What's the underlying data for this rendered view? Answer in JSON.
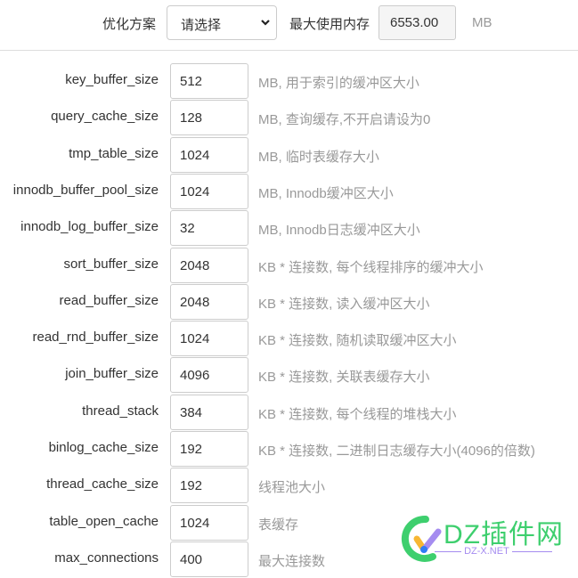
{
  "toolbar": {
    "scheme_label": "优化方案",
    "scheme_select_value": "请选择",
    "max_memory_label": "最大使用内存",
    "max_memory_value": "6553.00",
    "max_memory_unit": "MB"
  },
  "params": [
    {
      "name": "key_buffer_size",
      "value": "512",
      "desc": "MB, 用于索引的缓冲区大小"
    },
    {
      "name": "query_cache_size",
      "value": "128",
      "desc": "MB, 查询缓存,不开启请设为0"
    },
    {
      "name": "tmp_table_size",
      "value": "1024",
      "desc": "MB, 临时表缓存大小"
    },
    {
      "name": "innodb_buffer_pool_size",
      "value": "1024",
      "desc": "MB, Innodb缓冲区大小"
    },
    {
      "name": "innodb_log_buffer_size",
      "value": "32",
      "desc": "MB, Innodb日志缓冲区大小"
    },
    {
      "name": "sort_buffer_size",
      "value": "2048",
      "desc": "KB * 连接数, 每个线程排序的缓冲大小"
    },
    {
      "name": "read_buffer_size",
      "value": "2048",
      "desc": "KB * 连接数, 读入缓冲区大小"
    },
    {
      "name": "read_rnd_buffer_size",
      "value": "1024",
      "desc": "KB * 连接数, 随机读取缓冲区大小"
    },
    {
      "name": "join_buffer_size",
      "value": "4096",
      "desc": "KB * 连接数, 关联表缓存大小"
    },
    {
      "name": "thread_stack",
      "value": "384",
      "desc": "KB * 连接数, 每个线程的堆栈大小"
    },
    {
      "name": "binlog_cache_size",
      "value": "192",
      "desc": "KB * 连接数, 二进制日志缓存大小(4096的倍数)"
    },
    {
      "name": "thread_cache_size",
      "value": "192",
      "desc": "线程池大小"
    },
    {
      "name": "table_open_cache",
      "value": "1024",
      "desc": "表缓存"
    },
    {
      "name": "max_connections",
      "value": "400",
      "desc": "最大连接数"
    }
  ],
  "watermark": {
    "title": "DZ插件网",
    "subtitle": "DZ-X.NET",
    "colors": {
      "green": "#3ecf6e",
      "purple": "#a58cf0",
      "yellow": "#f7b733",
      "blue": "#2f7cf6"
    }
  }
}
